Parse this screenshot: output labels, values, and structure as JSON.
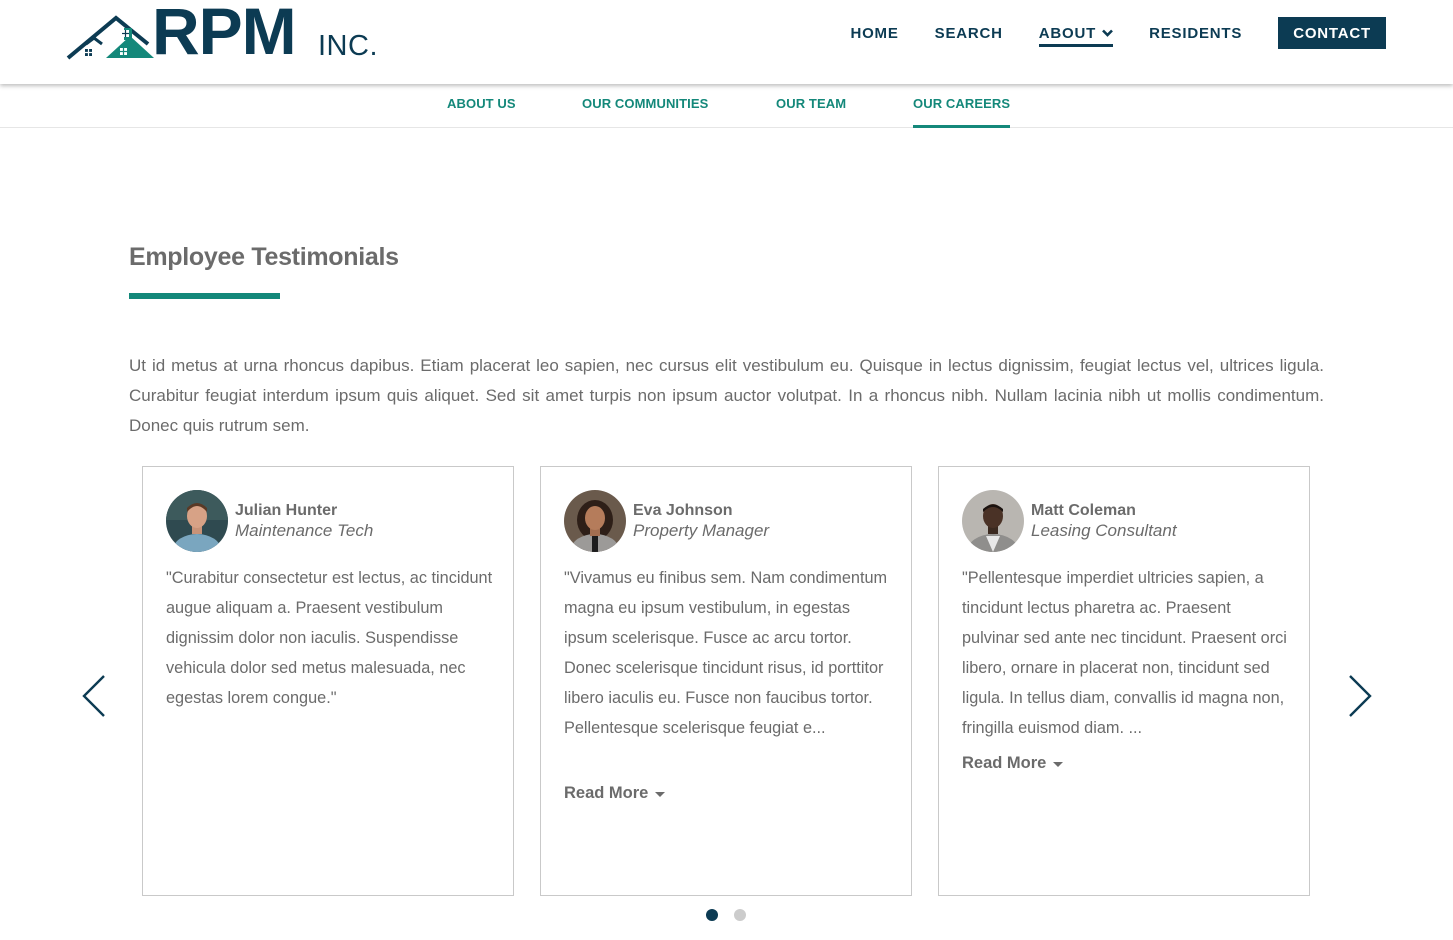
{
  "brand": {
    "name": "RPM",
    "suffix": "INC."
  },
  "nav": {
    "home": "HOME",
    "search": "SEARCH",
    "about": "ABOUT",
    "residents": "RESIDENTS",
    "contact": "CONTACT"
  },
  "subnav": {
    "about_us": "ABOUT US",
    "communities": "OUR COMMUNITIES",
    "team": "OUR TEAM",
    "careers": "OUR CAREERS"
  },
  "section": {
    "title": "Employee Testimonials",
    "intro": "Ut id metus at urna rhoncus dapibus. Etiam placerat leo sapien, nec cursus elit vestibulum eu. Quisque in lectus dignissim, feugiat lectus vel, ultrices ligula. Curabitur feugiat interdum ipsum quis aliquet. Sed sit amet turpis non ipsum auctor volutpat. In a rhoncus nibh. Nullam lacinia nibh ut mollis condimentum. Donec quis rutrum sem."
  },
  "testimonials": [
    {
      "name": "Julian Hunter",
      "role": "Maintenance Tech",
      "quote": "\"Curabitur consectetur est lectus, ac tincidunt augue aliquam a. Praesent vestibulum dignissim dolor non iaculis. Suspendisse vehicula dolor sed metus malesuada, nec egestas lorem congue.\""
    },
    {
      "name": "Eva Johnson",
      "role": "Property Manager",
      "quote": "\"Vivamus eu finibus sem. Nam condimentum magna eu ipsum vestibulum, in egestas ipsum scelerisque. Fusce ac arcu tortor. Donec scelerisque tincidunt risus, id porttitor libero iaculis eu. Fusce non faucibus tortor. Pellentesque scelerisque feugiat e...",
      "read_more": "Read More"
    },
    {
      "name": "Matt Coleman",
      "role": "Leasing Consultant",
      "quote": "\"Pellentesque imperdiet ultricies sapien, a tincidunt lectus pharetra ac. Praesent pulvinar sed ante nec tincidunt. Praesent orci libero, ornare in placerat non, tincidunt sed ligula. In tellus diam, convallis id magna non, fringilla euismod diam. ...",
      "read_more": "Read More"
    }
  ],
  "carousel": {
    "pages": 2,
    "active_page": 1
  },
  "colors": {
    "navy": "#0c3b53",
    "teal": "#14887a",
    "text_gray": "#6b6b6b",
    "dot_active": "#0c3b53",
    "dot_inactive": "#cccccc"
  }
}
